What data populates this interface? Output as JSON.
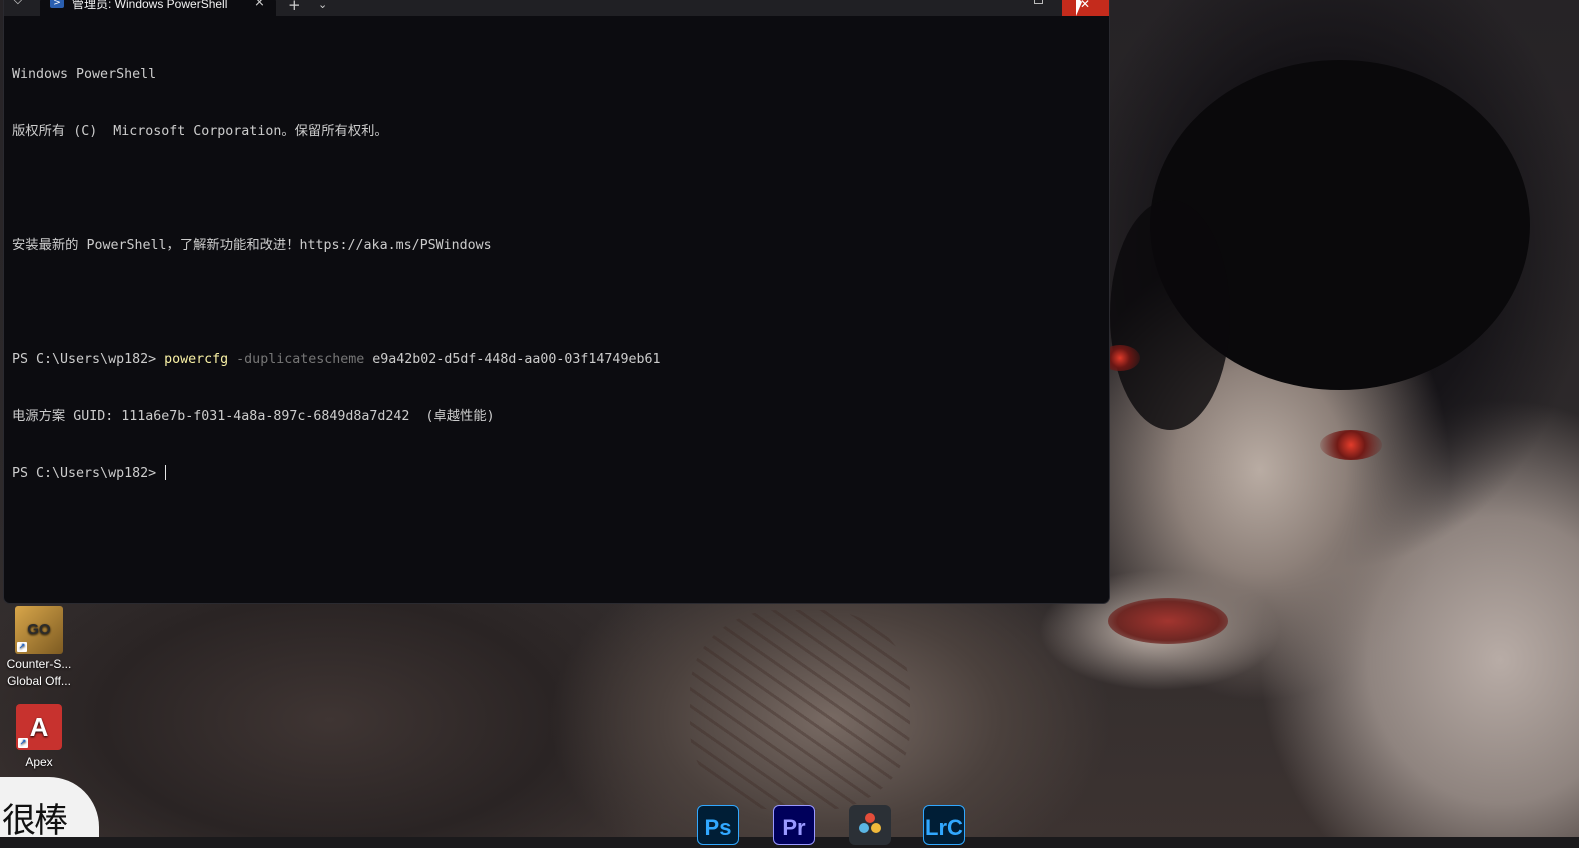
{
  "terminal": {
    "tab_title": "管理员: Windows PowerShell",
    "lines": [
      "Windows PowerShell",
      "版权所有 (C)  Microsoft Corporation。保留所有权利。",
      "",
      "安装最新的 PowerShell，了解新功能和改进！https://aka.ms/PSWindows",
      ""
    ],
    "command": {
      "prompt": "PS C:\\Users\\wp182> ",
      "cmdlet": "powercfg",
      "parameter": "-duplicatescheme",
      "argument": " e9a42b02-d5df-448d-aa00-03f14749eb61"
    },
    "output": "电源方案 GUID: 111a6e7b-f031-4a8a-897c-6849d8a7d242  (卓越性能)",
    "current_prompt": "PS C:\\Users\\wp182> "
  },
  "icons": {
    "shield": "shield-icon",
    "powershell": "powershell-icon",
    "close_tab": "×",
    "new_tab": "+",
    "dropdown": "⌄",
    "window_close": "✕"
  },
  "desktop": {
    "csgo": {
      "label_line1": "Counter-S...",
      "label_line2": "Global Off...",
      "logo_text": "GO"
    },
    "apex": {
      "label": "Apex",
      "logo_text": "A"
    },
    "sticker_text": "很棒"
  },
  "taskbar": {
    "photoshop": "Ps",
    "premiere": "Pr",
    "lightroom": "LrC"
  },
  "colors": {
    "terminal_bg": "#0c0c10",
    "close_button": "#c42b1c",
    "command_yellow": "#f9f1a5",
    "parameter_gray": "#767676"
  }
}
